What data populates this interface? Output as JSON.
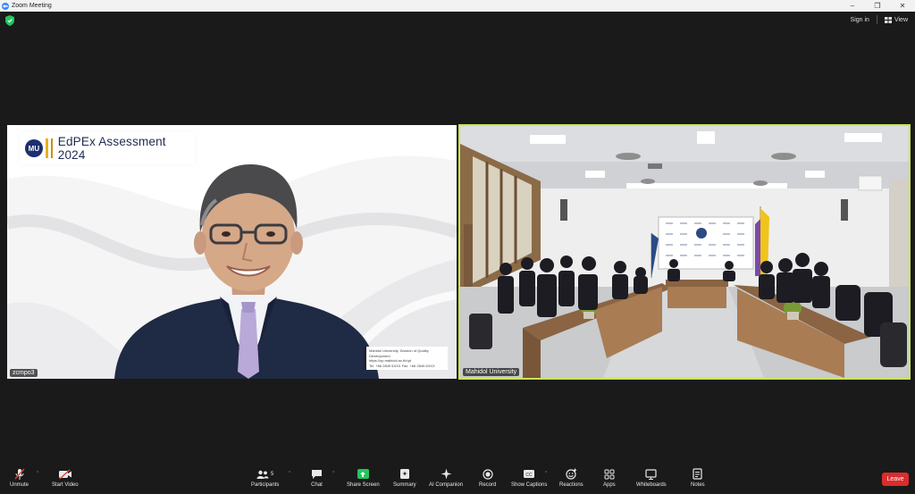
{
  "window": {
    "title": "Zoom Meeting"
  },
  "header": {
    "sign_in": "Sign in",
    "view": "View"
  },
  "tiles": {
    "left": {
      "banner_title": "EdPEx Assessment 2024",
      "logo_text": "MU",
      "contact_lines": [
        "Mahidol University, Division of Quality Development",
        "https://op.mahidol.ac.th/qd",
        "Tel. +66 2849 6XXX  Fax. +66 2849 6XXX"
      ],
      "name": "zcmpo3"
    },
    "right": {
      "name": "Mahidol University"
    }
  },
  "toolbar": {
    "unmute": "Unmute",
    "start_video": "Start Video",
    "participants": "Participants",
    "participants_count": "5",
    "chat": "Chat",
    "share_screen": "Share Screen",
    "summary": "Summary",
    "ai_companion": "AI Companion",
    "record": "Record",
    "show_captions": "Show Captions",
    "reactions": "Reactions",
    "apps": "Apps",
    "whiteboards": "Whiteboards",
    "notes": "Notes",
    "leave": "Leave"
  },
  "colors": {
    "active_speaker_border": "#c8e653",
    "leave": "#d92d2d",
    "share": "#23c55e",
    "brand": "#2d8cff"
  }
}
